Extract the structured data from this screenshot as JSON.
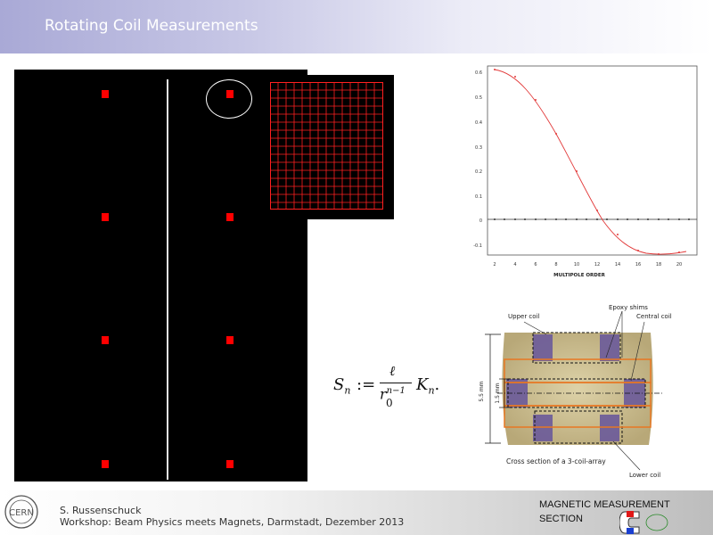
{
  "header": {
    "title": "Rotating Coil Measurements"
  },
  "footer": {
    "author": "S. Russenschuck",
    "event": "Workshop: Beam Physics meets Magnets, Darmstadt, Dezember 2013",
    "section_line1": "MAGNETIC MEASUREMENT",
    "section_line2": "SECTION"
  },
  "plot": {
    "xlabel": "MULTIPOLE ORDER",
    "xticks": [
      "2",
      "4",
      "6",
      "8",
      "10",
      "12",
      "14",
      "16",
      "18",
      "20"
    ],
    "yticks": [
      "0.6",
      "0.5",
      "0.4",
      "0.3",
      "0.2",
      "0.1",
      "0",
      "-0.1"
    ]
  },
  "formula": {
    "lhs": "S",
    "sub_n": "n",
    "assign": ":=",
    "numerator": "ℓ",
    "den_r": "r",
    "den_sub": "0",
    "den_exp": "n−1",
    "rhs": "K",
    "rhs_sub": "n",
    "period": "."
  },
  "photo": {
    "epoxy": "Epoxy shims",
    "upper": "Upper coil",
    "central": "Central coil",
    "lower": "Lower coil",
    "caption": "Cross section of a 3-coil-array",
    "dim1": "5.5 mm",
    "dim2": "1.5 mm"
  },
  "colors": {
    "accent_red": "#ff0000",
    "panel_black": "#000000",
    "plot_line": "#e23a3a",
    "orange_outline": "#e87722"
  }
}
